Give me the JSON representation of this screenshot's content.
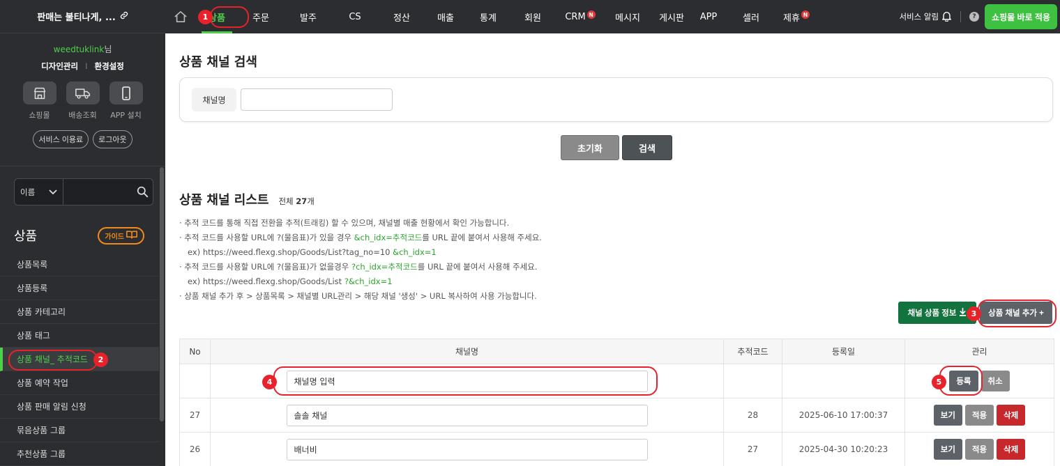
{
  "sidebar": {
    "shop_name": "판매는 불티나게, ...",
    "user_id": "weedtuklink",
    "user_suffix": "님",
    "link_design": "디자인관리",
    "link_separator": "I",
    "link_settings": "환경설정",
    "quick": [
      {
        "label": "쇼핑몰",
        "icon": "store-icon"
      },
      {
        "label": "배송조회",
        "icon": "truck-icon"
      },
      {
        "label": "APP 설치",
        "icon": "mobile-icon"
      }
    ],
    "btn_service_fee": "서비스 이용료",
    "btn_logout": "로그아웃",
    "search_select": "이름",
    "section_title": "상품",
    "guide_label": "가이드",
    "menu": [
      "상품목록",
      "상품등록",
      "상품 카테고리",
      "상품 태그",
      "상품 채널_ 추적코드",
      "상품 예약 작업",
      "상품 판매 알림 신청",
      "묶음상품 그룹",
      "추천상품 그룹"
    ],
    "active_index": 4
  },
  "topnav": {
    "items": [
      {
        "label": "상품",
        "badge": ""
      },
      {
        "label": "주문",
        "badge": ""
      },
      {
        "label": "발주",
        "badge": ""
      },
      {
        "label": "CS",
        "badge": ""
      },
      {
        "label": "정산",
        "badge": ""
      },
      {
        "label": "매출",
        "badge": ""
      },
      {
        "label": "통계",
        "badge": ""
      },
      {
        "label": "회원",
        "badge": ""
      },
      {
        "label": "CRM",
        "badge": "N"
      },
      {
        "label": "메시지",
        "badge": ""
      },
      {
        "label": "게시판",
        "badge": ""
      },
      {
        "label": "APP",
        "badge": ""
      },
      {
        "label": "셀러",
        "badge": ""
      },
      {
        "label": "제휴",
        "badge": "N"
      }
    ],
    "service_alarm": "서비스 알림",
    "help": "?",
    "apply_button": "쇼핑몰 바로 적용"
  },
  "search_section": {
    "title": "상품 채널 검색",
    "field_label": "채널명",
    "field_value": "",
    "reset_button": "초기화",
    "search_button": "검색"
  },
  "list_section": {
    "title": "상품 채널 리스트",
    "total_prefix": "전체 ",
    "total_count": "27",
    "total_suffix": "개",
    "notes": {
      "n1": "· 추적 코드를 통해 직접 전환을 추적(트래킹) 할 수 있으며, 채널별 매출 현황에서 확인 가능합니다.",
      "n2a": "· 추적 코드를 사용할 URL에 ?(물음표)가 있을 경우 ",
      "n2g": "&ch_idx=추적코드",
      "n2b": "를 URL 끝에 붙여서 사용해 주세요.",
      "n3a": "ex) https://weed.flexg.shop/Goods/List?tag_no=10 ",
      "n3g": "&ch_idx=1",
      "n4a": "· 추적 코드를 사용할 URL에 ?(물음표)가 없을경우 ",
      "n4g": "?ch_idx=추적코드",
      "n4b": "를 URL 끝에 붙여서 사용해 주세요.",
      "n5a": "ex) https://weed.flexg.shop/Goods/List ",
      "n5g": "?&ch_idx=1",
      "n6": "· 상품 채널 추가 후 > 상품목록 > 채널별 URL관리 > 해당 채널 '생성' > URL 복사하여 사용 가능합니다."
    },
    "channel_info_button": "채널 상품 정보",
    "add_channel_button": "상품 채널 추가 +"
  },
  "table": {
    "headers": [
      "No",
      "채널명",
      "추적코드",
      "등록일",
      "관리"
    ],
    "new_row": {
      "input_value": "채널명 입력",
      "register_button": "등록",
      "cancel_button": "취소"
    },
    "rows": [
      {
        "no": "27",
        "name": "솔솔 채널",
        "code": "28",
        "date": "2025-06-10 17:00:37"
      },
      {
        "no": "26",
        "name": "배너비",
        "code": "27",
        "date": "2025-04-30 10:20:23"
      }
    ],
    "row_buttons": {
      "view": "보기",
      "apply": "적용",
      "delete": "삭제"
    }
  },
  "annotations": [
    "1",
    "2",
    "3",
    "4",
    "5"
  ],
  "colors": {
    "brand_green": "#3ec140",
    "active_green": "#4fd04c",
    "dark_bg": "#2b2d30",
    "annotation_red": "#e8222a",
    "delete_red": "#c6282c",
    "channel_info_green": "#13733e"
  }
}
